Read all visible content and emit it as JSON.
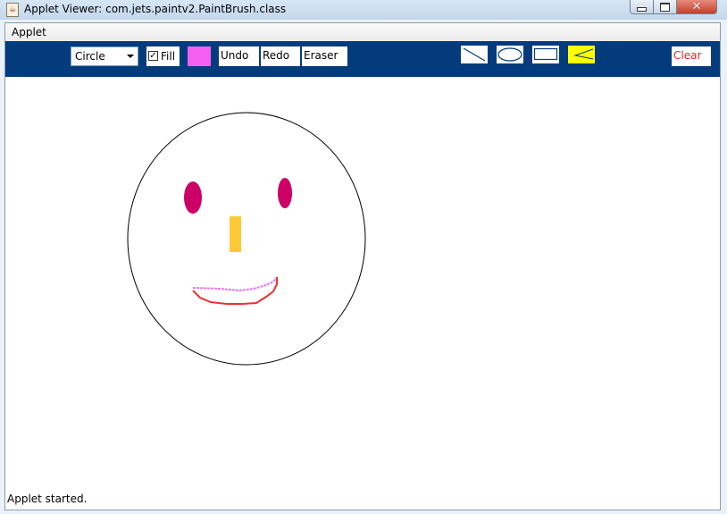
{
  "window": {
    "title": "Applet Viewer: com.jets.paintv2.PaintBrush.class",
    "icon": "java-cup-icon"
  },
  "menu": {
    "applet_label": "Applet"
  },
  "toolbar": {
    "shape_select": {
      "value": "Circle"
    },
    "fill_checkbox": {
      "label": "Fill",
      "checked": true
    },
    "color_swatch": {
      "color": "#f55ff0"
    },
    "undo_label": "Undo",
    "redo_label": "Redo",
    "eraser_label": "Eraser",
    "tools": [
      {
        "name": "line-tool-icon"
      },
      {
        "name": "oval-tool-icon"
      },
      {
        "name": "rectangle-tool-icon",
        "selected": false
      },
      {
        "name": "freehand-tool-icon",
        "selected": true
      }
    ],
    "clear_label": "Clear"
  },
  "colors": {
    "toolbar_bg": "#033b7c",
    "selected_tool": "#ffff00",
    "clear_text": "#e3262a",
    "eye": "#cc0066",
    "nose": "#ffc935",
    "smile_top": "#ee77ee",
    "smile_bottom": "#ee3030"
  },
  "status": {
    "text": "Applet started."
  }
}
